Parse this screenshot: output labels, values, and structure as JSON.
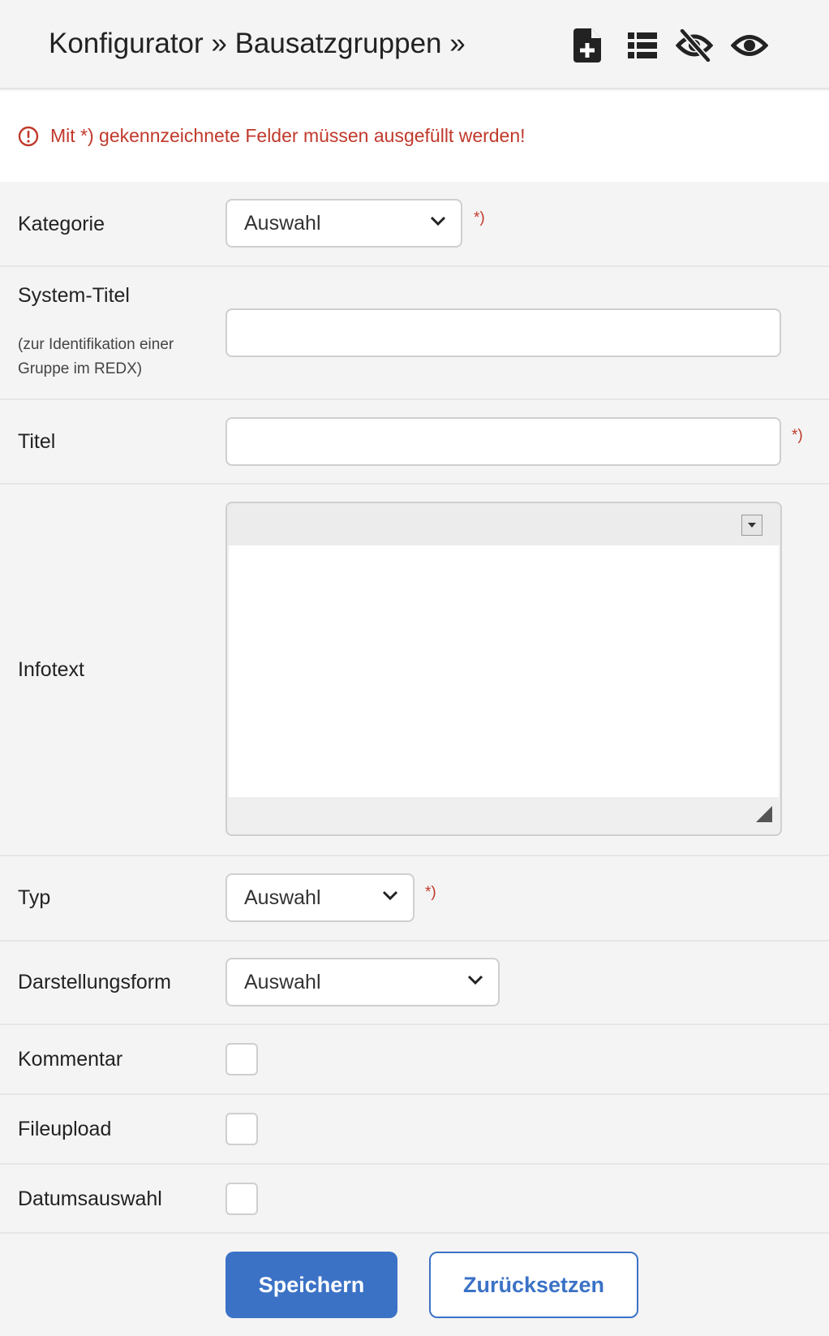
{
  "header": {
    "breadcrumb": "Konfigurator » Bausatzgruppen »",
    "icons": [
      "new-document-icon",
      "list-icon",
      "eye-slash-icon",
      "eye-icon"
    ]
  },
  "alert": {
    "text": "Mit *) gekennzeichnete Felder müssen ausgefüllt werden!",
    "color": "#c0392b"
  },
  "form": {
    "required_mark": "*)",
    "kategorie": {
      "label": "Kategorie",
      "value": "Auswahl"
    },
    "system_titel": {
      "label": "System-Titel",
      "hint": "(zur Identifikation einer Gruppe im REDX)",
      "value": ""
    },
    "titel": {
      "label": "Titel",
      "value": ""
    },
    "infotext": {
      "label": "Infotext",
      "value": ""
    },
    "typ": {
      "label": "Typ",
      "value": "Auswahl"
    },
    "darstellungsform": {
      "label": "Darstellungsform",
      "value": "Auswahl"
    },
    "kommentar": {
      "label": "Kommentar",
      "checked": false
    },
    "fileupload": {
      "label": "Fileupload",
      "checked": false
    },
    "datumsauswahl": {
      "label": "Datumsauswahl",
      "checked": false
    }
  },
  "actions": {
    "save_label": "Speichern",
    "reset_label": "Zurücksetzen",
    "accent": "#3b72c6"
  }
}
